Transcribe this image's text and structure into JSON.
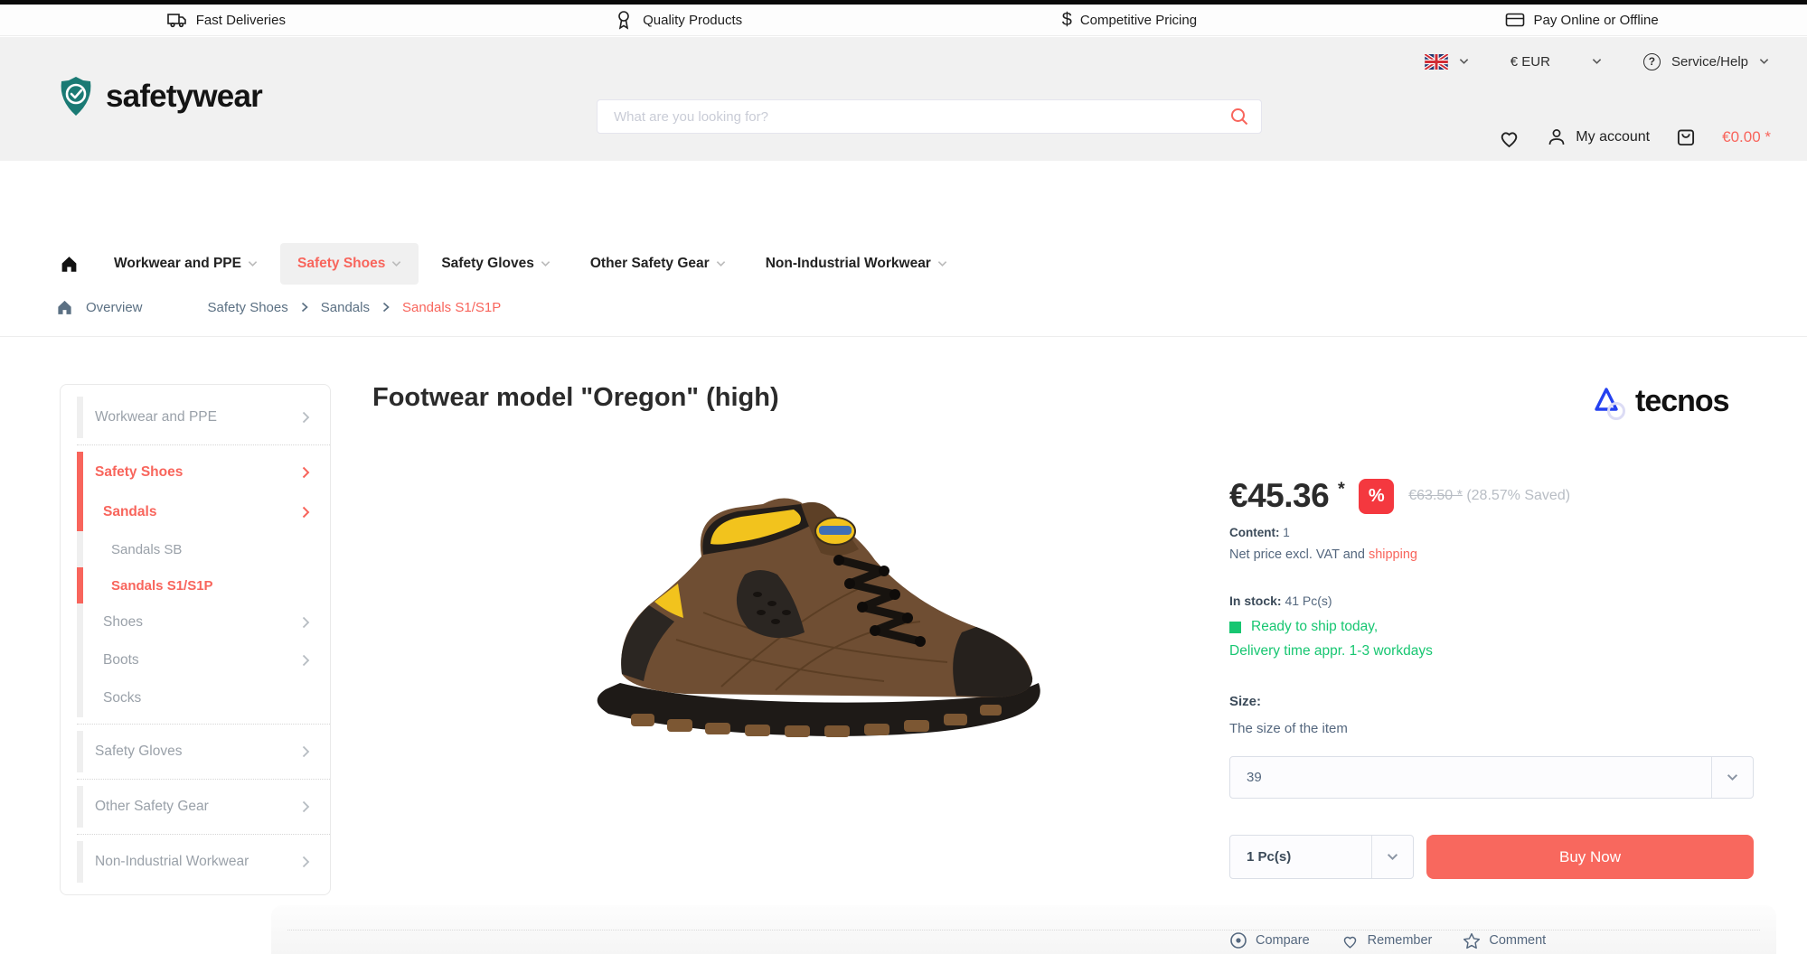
{
  "colors": {
    "accent": "#f8655c",
    "badge_red": "#f4383f",
    "green": "#17c671",
    "brand_teal": "#1a7a74",
    "tecnos_blue": "#2441f0"
  },
  "topbar": {
    "benefits": [
      {
        "icon": "truck-icon",
        "label": "Fast Deliveries"
      },
      {
        "icon": "award-icon",
        "label": "Quality Products"
      },
      {
        "icon": "dollar-icon",
        "label": "Competitive Pricing"
      },
      {
        "icon": "credit-card-icon",
        "label": "Pay Online or Offline"
      }
    ]
  },
  "header": {
    "brand": "safetywear",
    "language_flag": "uk-flag-icon",
    "currency": "€ EUR",
    "help": "Service/Help",
    "search_placeholder": "What are you looking for?",
    "account": "My account",
    "cart_total": "€0.00 *"
  },
  "nav": {
    "items": [
      {
        "label": "Workwear and PPE",
        "active": false
      },
      {
        "label": "Safety Shoes",
        "active": true
      },
      {
        "label": "Safety Gloves",
        "active": false
      },
      {
        "label": "Other Safety Gear",
        "active": false
      },
      {
        "label": "Non-Industrial Workwear",
        "active": false
      }
    ]
  },
  "breadcrumb": {
    "home": "Overview",
    "crumbs": [
      "Safety Shoes",
      "Sandals",
      "Sandals S1/S1P"
    ]
  },
  "sidebar": {
    "items": [
      {
        "label": "Workwear and PPE"
      },
      {
        "label": "Safety Shoes"
      },
      {
        "label": "Sandals"
      },
      {
        "label": "Sandals SB"
      },
      {
        "label": "Sandals S1/S1P"
      },
      {
        "label": "Shoes"
      },
      {
        "label": "Boots"
      },
      {
        "label": "Socks"
      },
      {
        "label": "Safety Gloves"
      },
      {
        "label": "Other Safety Gear"
      },
      {
        "label": "Non-Industrial Workwear"
      }
    ]
  },
  "product": {
    "title": "Footwear model \"Oregon\" (high)",
    "brand": "tecnos",
    "price": "€45.36",
    "price_asterisk": "*",
    "badge": "%",
    "old_price": "€63.50 *",
    "saved": "(28.57% Saved)",
    "content_label": "Content:",
    "content_value": "1",
    "net_price_text": "Net price excl. VAT and",
    "shipping_link": "shipping",
    "stock_label": "In stock:",
    "stock_value": "41 Pc(s)",
    "ready_text": "Ready to ship today,",
    "delivery_text": "Delivery time appr. 1-3 workdays",
    "size_label": "Size:",
    "size_desc": "The size of the item",
    "size_value": "39",
    "qty_value": "1 Pc(s)",
    "buy_label": "Buy Now",
    "actions": [
      {
        "icon": "compare-icon",
        "label": "Compare"
      },
      {
        "icon": "heart-icon",
        "label": "Remember"
      },
      {
        "icon": "star-icon",
        "label": "Comment"
      }
    ]
  }
}
